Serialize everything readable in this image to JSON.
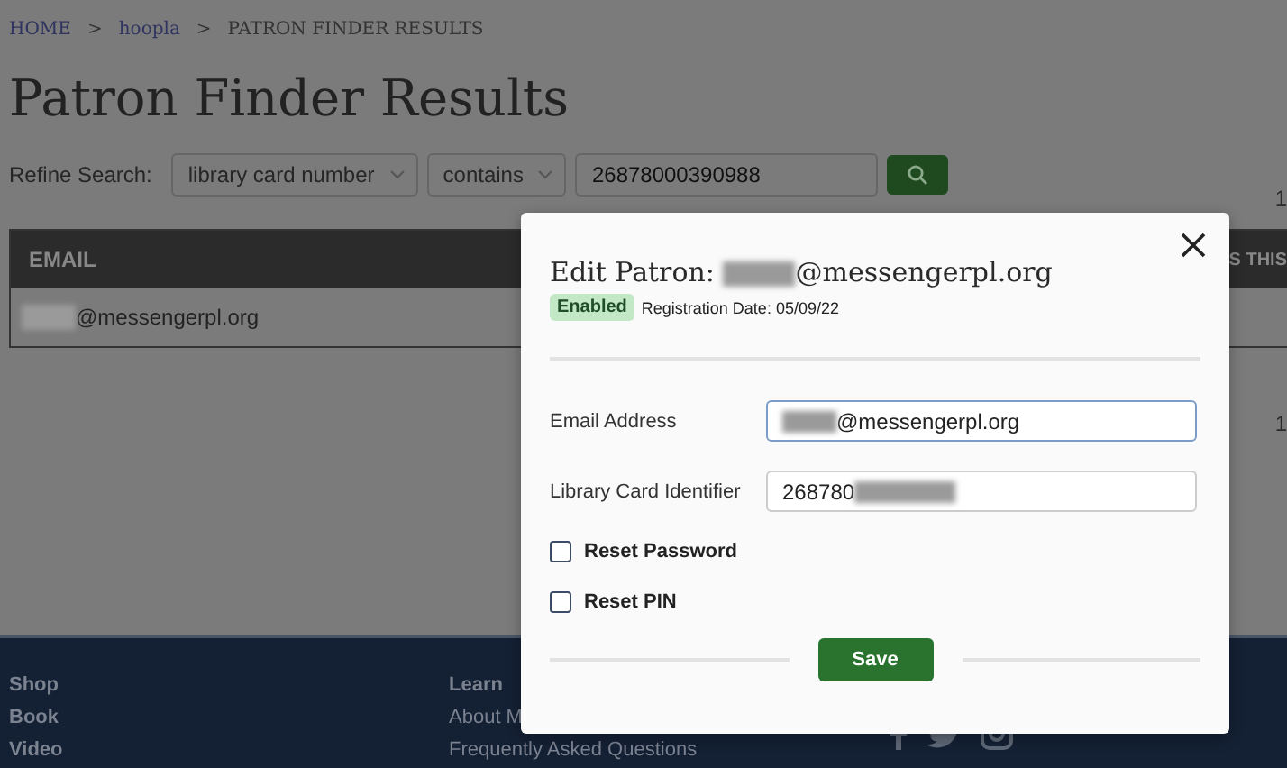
{
  "breadcrumb": [
    {
      "label": "HOME",
      "link": true
    },
    {
      "separator": ">",
      "label": "hoopla",
      "link": true
    },
    {
      "separator": ">",
      "label": "PATRON FINDER RESULTS",
      "link": false
    }
  ],
  "page_title": "Patron Finder Results",
  "refine_search": {
    "label": "Refine Search:",
    "field": "library card number",
    "operator": "contains",
    "value": "26878000390988"
  },
  "side_counts": [
    "1",
    "1"
  ],
  "table": {
    "columns": [
      "EMAIL",
      "S THIS"
    ],
    "rows": [
      {
        "email": "@messengerpl.org"
      }
    ]
  },
  "footer": {
    "columns": [
      {
        "heading": "Shop",
        "links": [
          "Book",
          "Video"
        ]
      },
      {
        "heading": "Learn",
        "links": [
          "About M",
          "Frequently Asked Questions"
        ]
      }
    ]
  },
  "modal": {
    "title_prefix": "Edit Patron:",
    "title_suffix": "@messengerpl.org",
    "status": "Enabled",
    "registration": "Registration Date: 05/09/22",
    "fields": [
      {
        "label": "Email Address",
        "value": "@messengerpl.org",
        "focused": true
      },
      {
        "label": "Library Card Identifier",
        "value": "268780",
        "focused": false
      }
    ],
    "checkboxes": [
      {
        "label": "Reset Password",
        "checked": false
      },
      {
        "label": "Reset PIN",
        "checked": false
      }
    ],
    "save": "Save"
  }
}
